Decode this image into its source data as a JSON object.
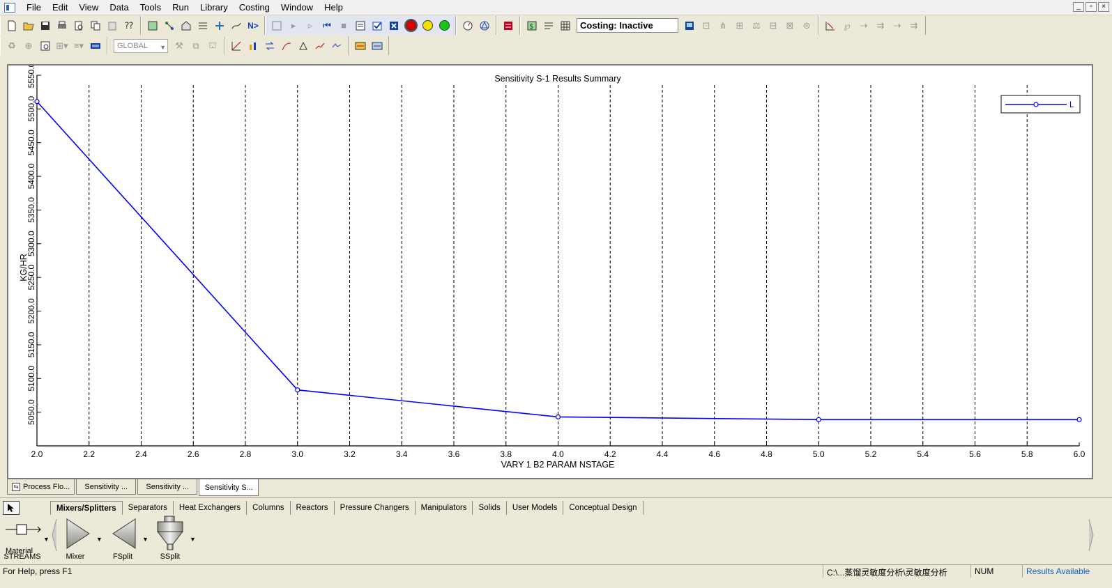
{
  "menu": {
    "items": [
      "File",
      "Edit",
      "View",
      "Data",
      "Tools",
      "Run",
      "Library",
      "Costing",
      "Window",
      "Help"
    ]
  },
  "toolbar": {
    "costing_status": "Costing: Inactive",
    "global_select": "GLOBAL",
    "next_label": "N>"
  },
  "chart_data": {
    "type": "line",
    "title": "Sensitivity S-1 Results Summary",
    "xlabel": "VARY   1 B2 PARAM NSTAGE",
    "ylabel": "KG/HR",
    "xlim": [
      2.0,
      6.0
    ],
    "ylim": [
      5000,
      5550
    ],
    "x_ticks": [
      2.0,
      2.2,
      2.4,
      2.6,
      2.8,
      3.0,
      3.2,
      3.4,
      3.6,
      3.8,
      4.0,
      4.2,
      4.4,
      4.6,
      4.8,
      5.0,
      5.2,
      5.4,
      5.6,
      5.8,
      6.0
    ],
    "y_ticks": [
      5050.0,
      5100.0,
      5150.0,
      5200.0,
      5250.0,
      5300.0,
      5350.0,
      5400.0,
      5450.0,
      5500.0,
      5550.0
    ],
    "grid": "vertical dashed",
    "legend_position": "top-right",
    "series": [
      {
        "name": "L",
        "color": "#0000ff",
        "x": [
          2.0,
          3.0,
          4.0,
          5.0,
          6.0
        ],
        "y": [
          5511,
          5083,
          5043,
          5039,
          5039
        ]
      }
    ]
  },
  "window_tabs": [
    {
      "label": "Process Flo...",
      "active": false
    },
    {
      "label": "Sensitivity ...",
      "active": false
    },
    {
      "label": "Sensitivity ...",
      "active": false
    },
    {
      "label": "Sensitivity S...",
      "active": true
    }
  ],
  "library": {
    "tabs": [
      "Mixers/Splitters",
      "Separators",
      "Heat Exchangers",
      "Columns",
      "Reactors",
      "Pressure Changers",
      "Manipulators",
      "Solids",
      "User Models",
      "Conceptual Design"
    ],
    "streams_label": "Material",
    "streams_caption": "STREAMS",
    "models": [
      "Mixer",
      "FSplit",
      "SSplit"
    ]
  },
  "status": {
    "help": "For Help, press F1",
    "path": "C:\\...蒸馏灵敏度分析\\灵敏度分析",
    "num": "NUM",
    "results": "Results Available"
  }
}
